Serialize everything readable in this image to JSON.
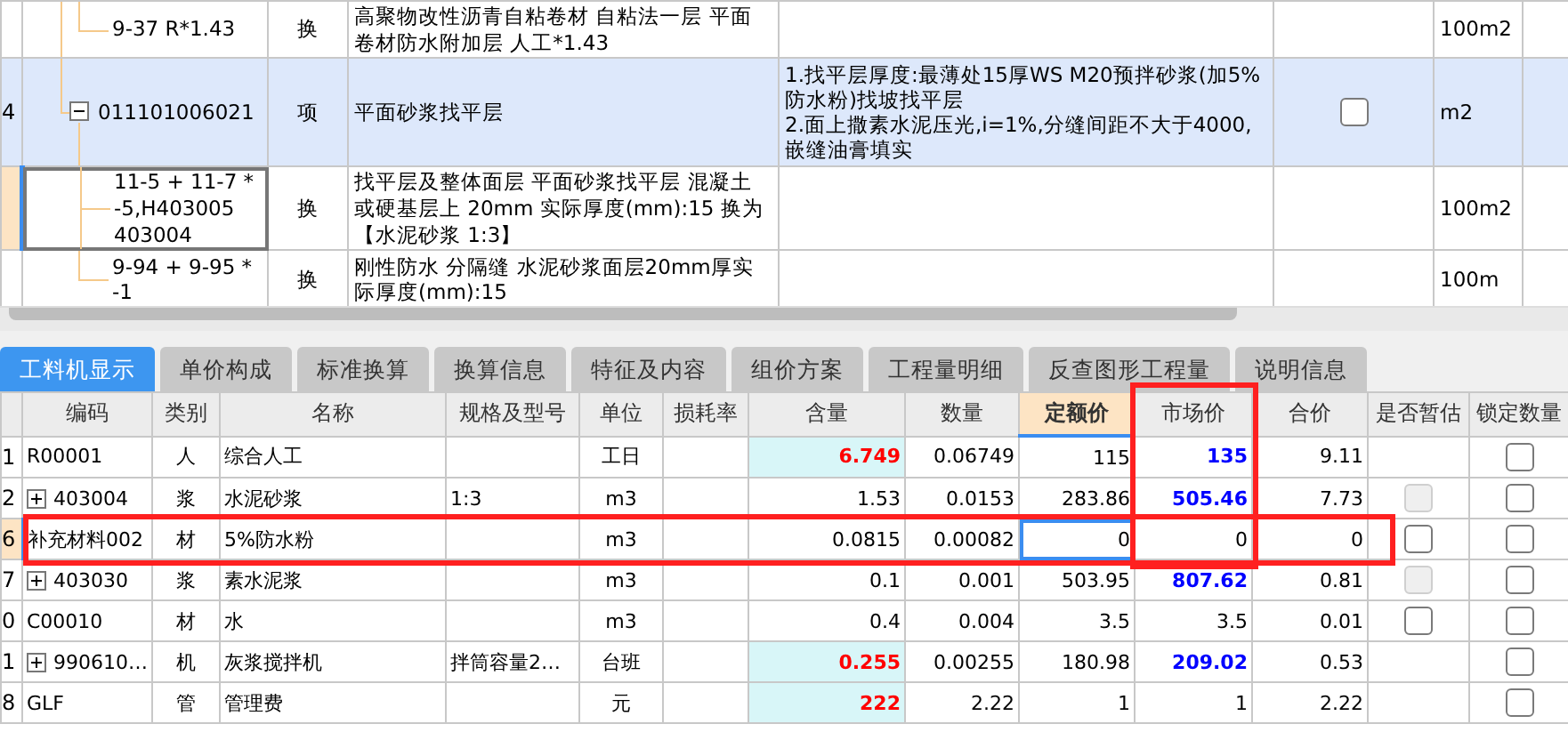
{
  "top_table": {
    "rows": [
      {
        "kind": "sub-item",
        "code": "9-37 R*1.43",
        "type": "换",
        "name": "高聚物改性沥青自粘卷材 自粘法一层 平面卷材防水附加层 人工*1.43",
        "unit": "100m2",
        "selected": false,
        "focused": false
      },
      {
        "kind": "item",
        "number": "4",
        "code": "011101006021",
        "type": "项",
        "name": "平面砂浆找平层",
        "features": "1.找平层厚度:最薄处15厚WS M20预拌砂浆(加5%防水粉)找坡找平层\n2.面上撒素水泥压光,i=1%,分缝间距不大于4000,嵌缝油膏填实",
        "checked": false,
        "unit": "m2",
        "selected": true,
        "focused": false,
        "expanded": true,
        "children": [
          {
            "kind": "sub-item",
            "code": "11-5 + 11-7 *\n-5,H403005\n403004",
            "type": "换",
            "name": "找平层及整体面层 平面砂浆找平层 混凝土或硬基层上 20mm  实际厚度(mm):15  换为【水泥砂浆 1:3】",
            "unit": "100m2",
            "selected": false,
            "focused": true
          },
          {
            "kind": "sub-item",
            "code": "9-94 + 9-95 *\n-1",
            "type": "换",
            "name": "刚性防水 分隔缝 水泥砂浆面层20mm厚实际厚度(mm):15",
            "unit": "100m",
            "selected": false,
            "focused": false
          }
        ]
      }
    ]
  },
  "tabs": [
    {
      "label": "工料机显示",
      "selected": true
    },
    {
      "label": "单价构成",
      "selected": false
    },
    {
      "label": "标准换算",
      "selected": false
    },
    {
      "label": "换算信息",
      "selected": false
    },
    {
      "label": "特征及内容",
      "selected": false
    },
    {
      "label": "组价方案",
      "selected": false
    },
    {
      "label": "工程量明细",
      "selected": false
    },
    {
      "label": "反查图形工程量",
      "selected": false
    },
    {
      "label": "说明信息",
      "selected": false
    }
  ],
  "columns": [
    {
      "label": "编码",
      "selected": false,
      "highlighted": false
    },
    {
      "label": "类别",
      "selected": false,
      "highlighted": false
    },
    {
      "label": "名称",
      "selected": false,
      "highlighted": false
    },
    {
      "label": "规格及型号",
      "selected": false,
      "highlighted": false
    },
    {
      "label": "单位",
      "selected": false,
      "highlighted": false
    },
    {
      "label": "损耗率",
      "selected": false,
      "highlighted": false
    },
    {
      "label": "含量",
      "selected": false,
      "highlighted": false
    },
    {
      "label": "数量",
      "selected": false,
      "highlighted": false
    },
    {
      "label": "定额价",
      "selected": true,
      "highlighted": false
    },
    {
      "label": "市场价",
      "selected": false,
      "highlighted": true
    },
    {
      "label": "合价",
      "selected": false,
      "highlighted": false
    },
    {
      "label": "是否暂估",
      "selected": false,
      "highlighted": false
    },
    {
      "label": "锁定数量",
      "selected": false,
      "highlighted": false
    }
  ],
  "rows": [
    {
      "number": "1",
      "expandable": false,
      "code": "R00001",
      "type": "人",
      "name": "综合人工",
      "unit": "工日",
      "content": "6.749",
      "quantity": "0.06749",
      "base_price": "115",
      "market_price": "135",
      "total": "9.11",
      "content_adjusted": true,
      "price_changed": true,
      "locked": false,
      "selected": false,
      "highlighted": false
    },
    {
      "number": "2",
      "expandable": true,
      "code": "403004",
      "type": "浆",
      "name": "水泥砂浆",
      "spec": "1:3",
      "unit": "m3",
      "content": "1.53",
      "quantity": "0.0153",
      "base_price": "283.86",
      "market_price": "505.46",
      "total": "7.73",
      "content_adjusted": false,
      "price_changed": true,
      "estimate": {
        "checked": false,
        "disabled": true
      },
      "locked": false,
      "selected": false,
      "highlighted": false
    },
    {
      "number": "6",
      "expandable": false,
      "code": "补充材料002",
      "type": "材",
      "name": "5%防水粉",
      "unit": "m3",
      "content": "0.0815",
      "quantity": "0.00082",
      "base_price": "0",
      "market_price": "0",
      "total": "0",
      "content_adjusted": false,
      "price_changed": false,
      "estimate": {
        "checked": false,
        "disabled": false
      },
      "locked": false,
      "selected": true,
      "highlighted": true
    },
    {
      "number": "7",
      "expandable": true,
      "code": "403030",
      "type": "浆",
      "name": "素水泥浆",
      "unit": "m3",
      "content": "0.1",
      "quantity": "0.001",
      "base_price": "503.95",
      "market_price": "807.62",
      "total": "0.81",
      "content_adjusted": false,
      "price_changed": true,
      "estimate": {
        "checked": false,
        "disabled": true
      },
      "locked": false,
      "selected": false,
      "highlighted": false
    },
    {
      "number": "0",
      "expandable": false,
      "code": "C00010",
      "type": "材",
      "name": "水",
      "unit": "m3",
      "content": "0.4",
      "quantity": "0.004",
      "base_price": "3.5",
      "market_price": "3.5",
      "total": "0.01",
      "content_adjusted": false,
      "price_changed": false,
      "estimate": {
        "checked": false,
        "disabled": false
      },
      "locked": false,
      "selected": false,
      "highlighted": false
    },
    {
      "number": "1",
      "expandable": true,
      "code": "990610…",
      "type": "机",
      "name": "灰浆搅拌机",
      "spec": "拌筒容量2…",
      "unit": "台班",
      "content": "0.255",
      "quantity": "0.00255",
      "base_price": "180.98",
      "market_price": "209.02",
      "total": "0.53",
      "content_adjusted": true,
      "price_changed": true,
      "locked": false,
      "selected": false,
      "highlighted": false
    },
    {
      "number": "8",
      "expandable": false,
      "code": "GLF",
      "type": "管",
      "name": "管理费",
      "unit": "元",
      "content": "222",
      "quantity": "2.22",
      "base_price": "1",
      "market_price": "1",
      "total": "2.22",
      "content_adjusted": true,
      "price_changed": false,
      "locked": false,
      "selected": false,
      "highlighted": false
    }
  ]
}
